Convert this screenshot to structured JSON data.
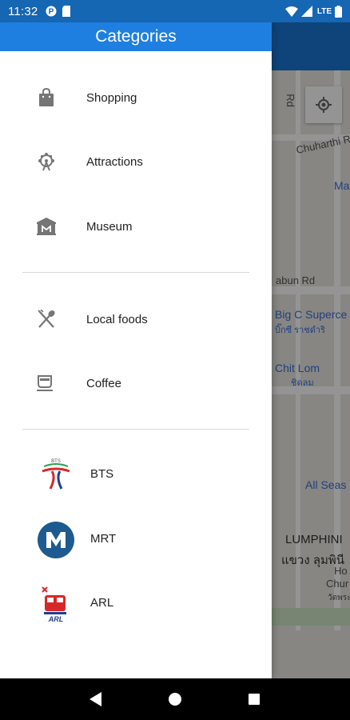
{
  "status_bar": {
    "time": "11:32",
    "network": "LTE",
    "icons": [
      "p-icon",
      "sd-card-icon",
      "wifi-icon",
      "signal-icon",
      "battery-icon"
    ]
  },
  "drawer": {
    "title": "Categories",
    "primary_items": [
      {
        "label": "Shopping",
        "icon": "shopping-bag-icon"
      },
      {
        "label": "Attractions",
        "icon": "ferris-wheel-icon"
      },
      {
        "label": "Museum",
        "icon": "museum-icon"
      }
    ],
    "food_items": [
      {
        "label": "Local foods",
        "icon": "utensils-icon"
      },
      {
        "label": "Coffee",
        "icon": "coffee-cup-icon"
      }
    ],
    "transit_items": [
      {
        "label": "BTS",
        "icon": "bts-logo"
      },
      {
        "label": "MRT",
        "icon": "mrt-logo"
      },
      {
        "label": "ARL",
        "icon": "arl-logo"
      }
    ]
  },
  "map": {
    "labels": [
      "Rd",
      "Chuharthi R",
      "Ma",
      "abun Rd",
      "Big C Superce",
      "บิ๊กซี ราชดำริ",
      "Chit Lom",
      "ชิดลม",
      "All Seas",
      "LUMPHINI",
      "แขวง ลุมพินี",
      "Ho",
      "Chur",
      "วัดพระ"
    ]
  },
  "colors": {
    "drawer_header": "#1e7fe0",
    "status_bar": "#1566b3",
    "icon_gray": "#757575",
    "mrt_blue": "#1d5a8f",
    "bts_red": "#d62828"
  }
}
